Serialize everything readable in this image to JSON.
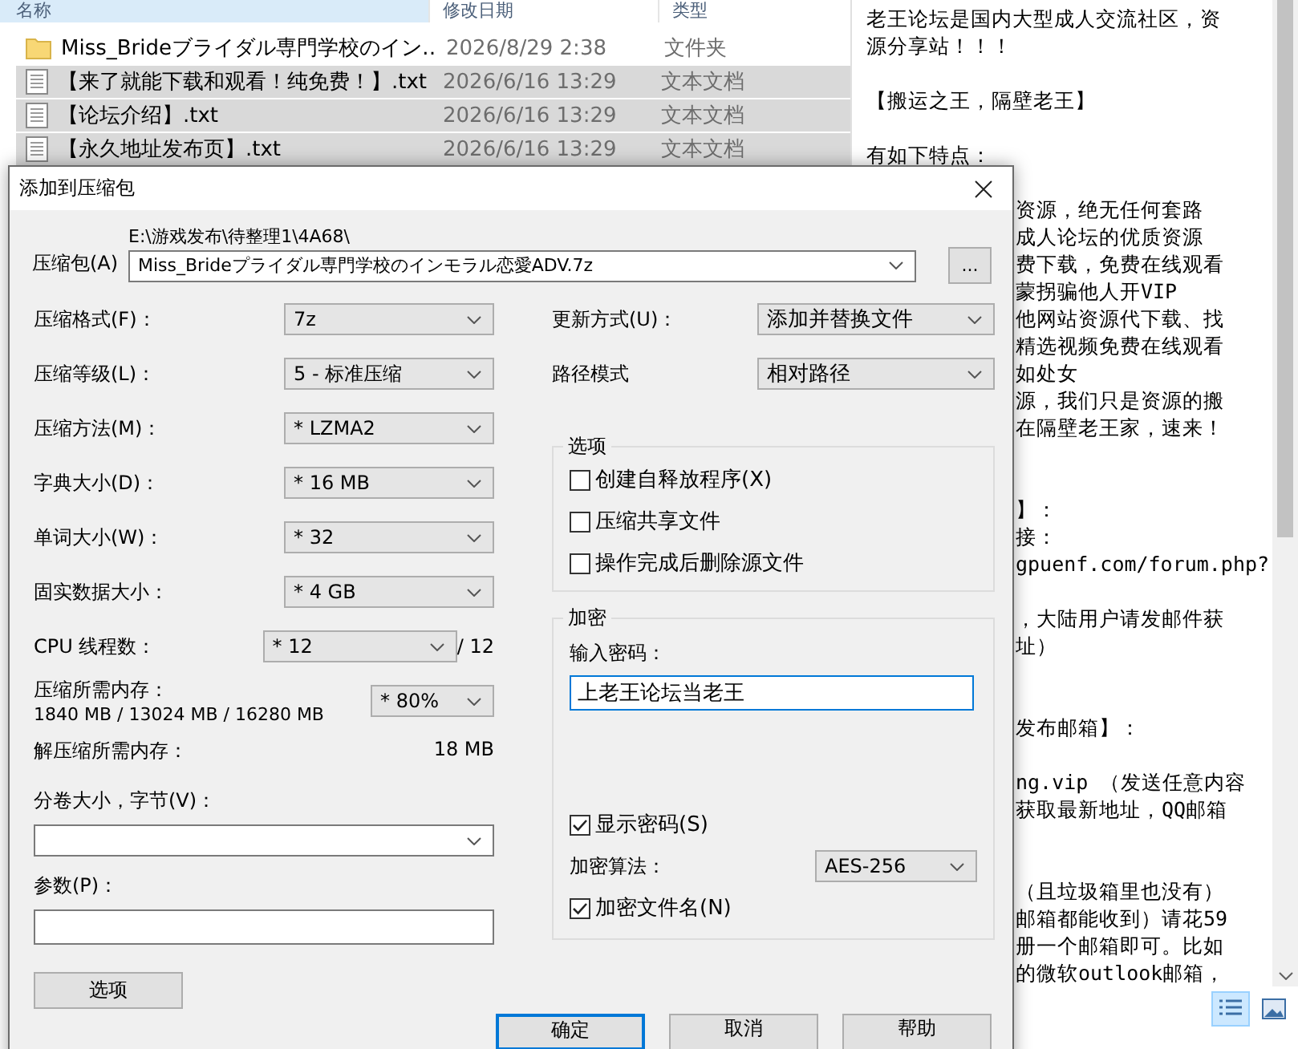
{
  "explorer": {
    "columns": [
      "名称",
      "修改日期",
      "类型"
    ],
    "rows": [
      {
        "name": "Miss_Brideブライダル専門学校のイン…",
        "date": "2026/8/29 2:38",
        "type": "文件夹",
        "kind": "folder",
        "selected": false
      },
      {
        "name": "【来了就能下载和观看！纯免费！】.txt",
        "date": "2026/6/16 13:29",
        "type": "文本文档",
        "kind": "text",
        "selected": true
      },
      {
        "name": "【论坛介绍】.txt",
        "date": "2026/6/16 13:29",
        "type": "文本文档",
        "kind": "text",
        "selected": true
      },
      {
        "name": "【永久地址发布页】.txt",
        "date": "2026/6/16 13:29",
        "type": "文本文档",
        "kind": "text",
        "selected": true
      }
    ]
  },
  "text_preview": {
    "lines": [
      {
        "kind": "full",
        "text": "老王论坛是国内大型成人交流社区，资"
      },
      {
        "kind": "full",
        "text": "源分享站！！！"
      },
      {
        "kind": "blank"
      },
      {
        "kind": "full",
        "text": "【搬运之王，隔壁老王】"
      },
      {
        "kind": "blank"
      },
      {
        "kind": "full",
        "text": "有如下特点："
      },
      {
        "kind": "blank"
      },
      {
        "kind": "covered",
        "text": "资源，绝无任何套路"
      },
      {
        "kind": "covered",
        "text": "成人论坛的优质资源"
      },
      {
        "kind": "covered",
        "text": "费下载，免费在线观看"
      },
      {
        "kind": "covered",
        "text": "蒙拐骗他人开VIP"
      },
      {
        "kind": "covered",
        "text": "他网站资源代下载、找"
      },
      {
        "kind": "covered",
        "text": "精选视频免费在线观看"
      },
      {
        "kind": "covered",
        "text": "如处女"
      },
      {
        "kind": "covered",
        "text": "源，我们只是资源的搬"
      },
      {
        "kind": "covered",
        "text": "在隔壁老王家，速来！"
      },
      {
        "kind": "blank"
      },
      {
        "kind": "blank"
      },
      {
        "kind": "covered",
        "text": "】："
      },
      {
        "kind": "covered",
        "text": "接："
      },
      {
        "kind": "covered",
        "text": "gpuenf.com/forum.php?"
      },
      {
        "kind": "blank"
      },
      {
        "kind": "covered",
        "text": "，大陆用户请发邮件获"
      },
      {
        "kind": "covered",
        "text": "址）"
      },
      {
        "kind": "blank"
      },
      {
        "kind": "blank"
      },
      {
        "kind": "covered",
        "text": "发布邮箱】："
      },
      {
        "kind": "blank"
      },
      {
        "kind": "covered",
        "text": "ng.vip  （发送任意内容"
      },
      {
        "kind": "covered",
        "text": "获取最新地址，QQ邮箱"
      },
      {
        "kind": "blank"
      },
      {
        "kind": "blank"
      },
      {
        "kind": "covered",
        "text": "（且垃圾箱里也没有）"
      },
      {
        "kind": "covered",
        "text": "邮箱都能收到）请花59"
      },
      {
        "kind": "covered",
        "text": "册一个邮箱即可。比如"
      },
      {
        "kind": "covered",
        "text": "的微软outlook邮箱，"
      }
    ]
  },
  "dialog": {
    "title": "添加到压缩包",
    "archive": {
      "label": "压缩包(A)",
      "path": "E:\\游戏发布\\待整理1\\4A68\\",
      "value": "Miss_Brideプライダル専門学校のインモラル恋愛ADV.7z",
      "browse": "..."
    },
    "left_settings": [
      {
        "label": "压缩格式(F)：",
        "value": "7z"
      },
      {
        "label": "压缩等级(L)：",
        "value": "5 - 标准压缩"
      },
      {
        "label": "压缩方法(M)：",
        "value": "* LZMA2"
      },
      {
        "label": "字典大小(D)：",
        "value": "* 16 MB"
      },
      {
        "label": "单词大小(W)：",
        "value": "* 32"
      },
      {
        "label": "固实数据大小：",
        "value": "* 4 GB"
      }
    ],
    "threads": {
      "label": "CPU 线程数：",
      "value": "* 12",
      "max": "/ 12"
    },
    "memory": {
      "label": "压缩所需内存：",
      "detail": "1840 MB / 13024 MB / 16280 MB",
      "value": "* 80%"
    },
    "decompress_memory": {
      "label": "解压缩所需内存：",
      "value": "18 MB"
    },
    "volume": {
      "label": "分卷大小，字节(V)："
    },
    "params": {
      "label": "参数(P)："
    },
    "options_button": "选项",
    "right_settings": [
      {
        "label": "更新方式(U)：",
        "value": "添加并替换文件"
      },
      {
        "label": "路径模式",
        "value": "相对路径"
      }
    ],
    "options_group": {
      "title": "选项",
      "checkboxes": [
        {
          "label": "创建自释放程序(X)",
          "checked": false
        },
        {
          "label": "压缩共享文件",
          "checked": false
        },
        {
          "label": "操作完成后删除源文件",
          "checked": false
        }
      ]
    },
    "encryption": {
      "title": "加密",
      "password_label": "输入密码：",
      "password": "上老王论坛当老王",
      "show_password": {
        "label": "显示密码(S)",
        "checked": true
      },
      "method_label": "加密算法：",
      "method": "AES-256",
      "encrypt_names": {
        "label": "加密文件名(N)",
        "checked": true
      }
    },
    "buttons": [
      {
        "label": "确定",
        "default": true
      },
      {
        "label": "取消",
        "default": false
      },
      {
        "label": "帮助",
        "default": false
      }
    ]
  }
}
